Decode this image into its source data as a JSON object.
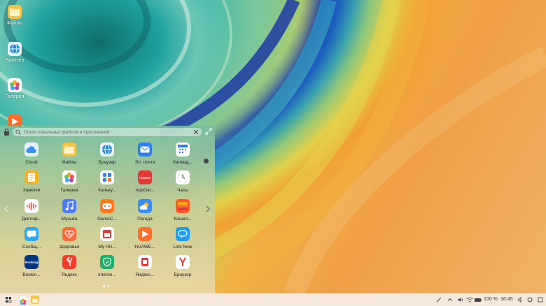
{
  "desktop": {
    "icons": [
      {
        "label": "Файлы",
        "icon": "files-icon"
      },
      {
        "label": "Браузер",
        "icon": "browser-icon"
      },
      {
        "label": "Галерея",
        "icon": "gallery-icon"
      },
      {
        "label": "",
        "icon": "huawei-video-icon"
      }
    ]
  },
  "drawer": {
    "search_placeholder": "Поиск локальных файлов и приложений",
    "apps": [
      {
        "label": "Cloud",
        "icon": "cloud-icon"
      },
      {
        "label": "Файлы",
        "icon": "files-icon"
      },
      {
        "label": "Браузер",
        "icon": "browser-icon"
      },
      {
        "label": "Эл. почта",
        "icon": "email-icon"
      },
      {
        "label": "Календ...",
        "icon": "calendar-icon"
      },
      {
        "label": "Заметки",
        "icon": "notes-icon"
      },
      {
        "label": "Галерея",
        "icon": "gallery-icon"
      },
      {
        "label": "Кальку...",
        "icon": "calculator-icon"
      },
      {
        "label": "AppGal...",
        "icon": "appgallery-icon"
      },
      {
        "label": "Часы",
        "icon": "clock-icon"
      },
      {
        "label": "Диктоф...",
        "icon": "recorder-icon"
      },
      {
        "label": "Музыка",
        "icon": "music-icon"
      },
      {
        "label": "GameC...",
        "icon": "gamecenter-icon"
      },
      {
        "label": "Погода",
        "icon": "weather-icon"
      },
      {
        "label": "Кошел...",
        "icon": "wallet-icon"
      },
      {
        "label": "Сообщ...",
        "icon": "messages-icon"
      },
      {
        "label": "Здоровье",
        "icon": "health-icon"
      },
      {
        "label": "My HU...",
        "icon": "myhuawei-icon"
      },
      {
        "label": "HUAWE...",
        "icon": "huawei-video-icon"
      },
      {
        "label": "Link Now",
        "icon": "linknow-icon"
      },
      {
        "label": "Bookin...",
        "icon": "booking-icon"
      },
      {
        "label": "Яндекс",
        "icon": "yandex-icon"
      },
      {
        "label": "Interne...",
        "icon": "internet-icon"
      },
      {
        "label": "Яндекс...",
        "icon": "yandex-market-icon"
      },
      {
        "label": "Браузер",
        "icon": "yandex-browser-icon"
      }
    ],
    "booking_text": "Booking",
    "appgallery_text": "HUAWEI",
    "pages": 2,
    "current_page": 1
  },
  "taskbar": {
    "battery": "100 %",
    "time": "16:45"
  },
  "colors": {
    "taskbar_bg": "#f6e9da",
    "drawer_text": "#222222"
  }
}
